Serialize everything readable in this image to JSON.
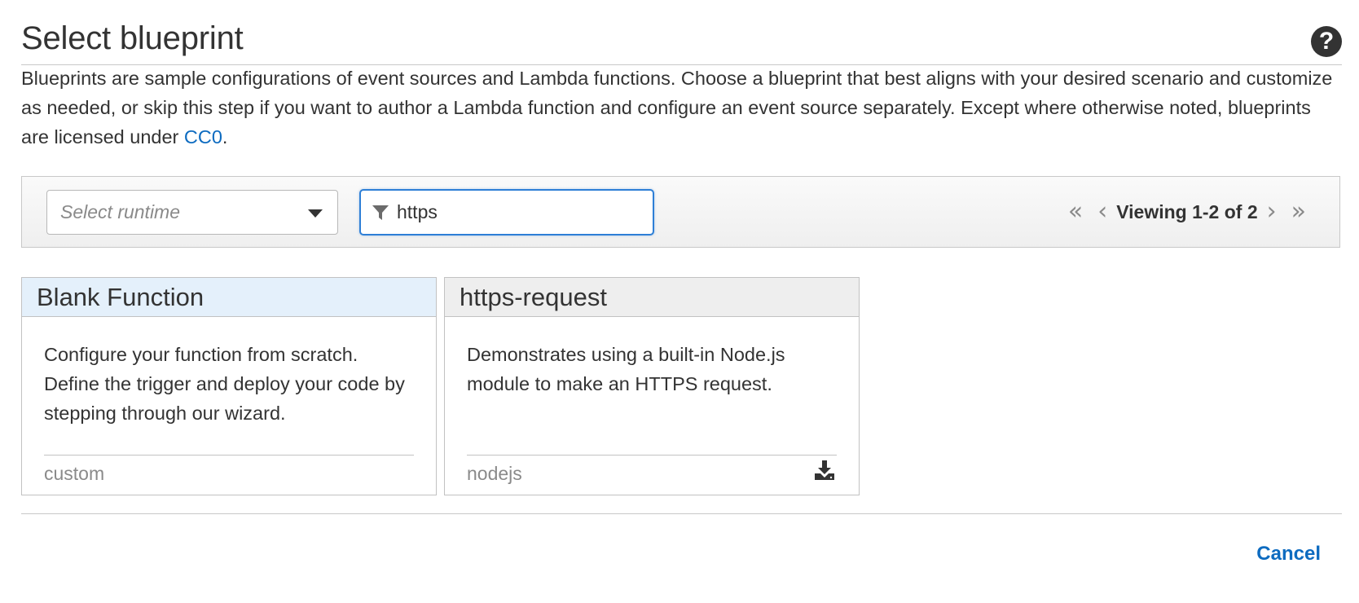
{
  "header": {
    "title": "Select blueprint",
    "help_icon": "question-circle-icon"
  },
  "description": {
    "text": "Blueprints are sample configurations of event sources and Lambda functions. Choose a blueprint that best aligns with your desired scenario and customize as needed, or skip this step if you want to author a Lambda function and configure an event source separately. Except where otherwise noted, blueprints are licensed under ",
    "link_text": "CC0",
    "suffix": "."
  },
  "toolbar": {
    "runtime_select": {
      "placeholder": "Select runtime"
    },
    "filter": {
      "value": "https"
    },
    "pager": {
      "first": "«",
      "prev": "‹",
      "text": "Viewing 1-2 of 2",
      "next": "›",
      "last": "»"
    }
  },
  "blueprints": [
    {
      "title": "Blank Function",
      "description": "Configure your function from scratch. Define the trigger and deploy your code by stepping through our wizard.",
      "runtime": "custom",
      "selected": true,
      "has_download": false
    },
    {
      "title": "https-request",
      "description": "Demonstrates using a built-in Node.js module to make an HTTPS request.",
      "runtime": "nodejs",
      "selected": false,
      "has_download": true
    }
  ],
  "footer": {
    "cancel_label": "Cancel"
  },
  "colors": {
    "accent": "#0d6bc0",
    "selected_header": "#e4f0fb",
    "default_header": "#eeeeee",
    "focus_border": "#2e7fd6"
  }
}
